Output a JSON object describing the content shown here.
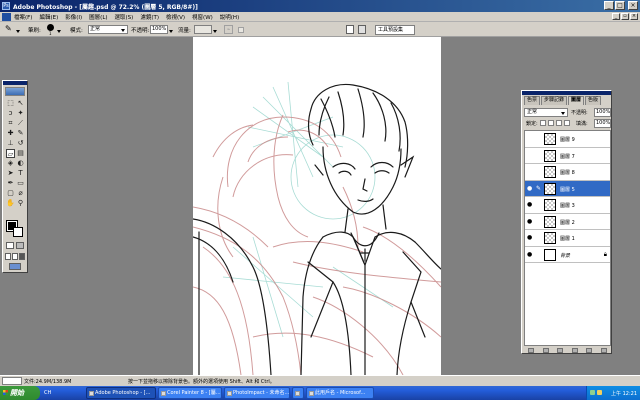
{
  "window": {
    "title": "Adobe Photoshop - [屬趣.psd @ 72.2% (圖層 5, RGB/8#)]"
  },
  "menu": {
    "items": [
      "檔案(F)",
      "編輯(E)",
      "影像(I)",
      "圖層(L)",
      "選取(S)",
      "濾鏡(T)",
      "檢視(V)",
      "視窗(W)",
      "說明(H)"
    ]
  },
  "options": {
    "brush_label": "筆刷:",
    "brush_size": "1",
    "mode_label": "模式:",
    "mode_value": "正常",
    "opacity_label": "不透明:",
    "opacity_value": "100%",
    "flow_label": "流量:",
    "flow_value": "",
    "erase_history_label": "",
    "palette_well_label": "工具預設集"
  },
  "layers_panel": {
    "tabs": [
      "色票",
      "步驟記錄",
      "圖層",
      "色版"
    ],
    "active_tab": "圖層",
    "blend_mode": "正常",
    "opacity_label": "不透明:",
    "opacity_value": "100%",
    "lock_label": "鎖定:",
    "fill_label": "填滿:",
    "fill_value": "100%",
    "layers": [
      {
        "name": "圖層 9",
        "visible": false,
        "active": false
      },
      {
        "name": "圖層 7",
        "visible": false,
        "active": false
      },
      {
        "name": "圖層 8",
        "visible": false,
        "active": false
      },
      {
        "name": "圖層 5",
        "visible": true,
        "active": true
      },
      {
        "name": "圖層 3",
        "visible": true,
        "active": false
      },
      {
        "name": "圖層 2",
        "visible": true,
        "active": false
      },
      {
        "name": "圖層 1",
        "visible": true,
        "active": false
      },
      {
        "name": "背景",
        "visible": true,
        "active": false,
        "locked": true
      }
    ]
  },
  "status": {
    "zoom": "",
    "doc_size": "文件:24.9M/138.9M",
    "hint": "按一下並拖移以擦除背景色。額外的選項使用 Shift、Alt 和 Ctrl。"
  },
  "taskbar": {
    "start_label": "開始",
    "lang": "CH",
    "tasks": [
      {
        "label": "Adobe Photoshop - [...",
        "active": true
      },
      {
        "label": "Corel Painter 8 - [屬...",
        "active": false
      },
      {
        "label": "PhotoImpact - 未命名...",
        "active": false
      },
      {
        "label": "",
        "active": false
      },
      {
        "label": "此用戶名 - Microsof...",
        "active": false
      }
    ],
    "clock": "上午 12:21"
  },
  "colors": {
    "titlebar": "#0a246a",
    "chrome": "#d4d0c8",
    "workspace": "#808080",
    "selection": "#316ac5",
    "sketch_red": "#c98a8a",
    "sketch_cyan": "#9fd8d0",
    "lineart": "#1a1a1a"
  }
}
